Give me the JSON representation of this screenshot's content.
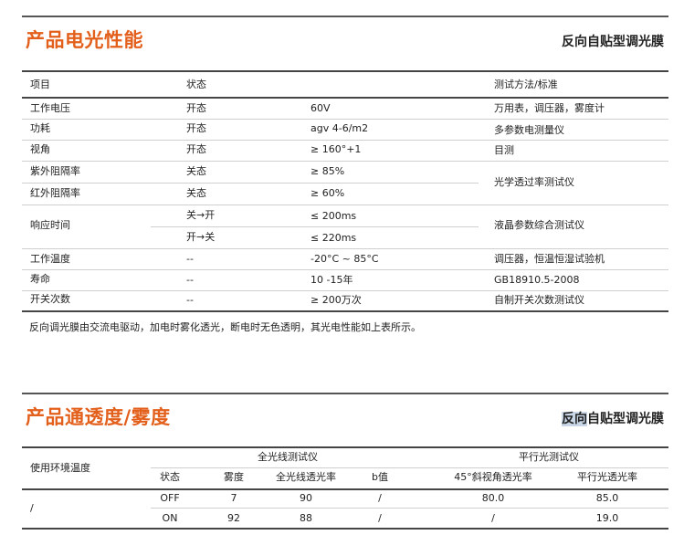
{
  "section1": {
    "title": "产品电光性能",
    "subtitle": "反向自贴型调光膜",
    "headers": {
      "item": "项目",
      "state": "状态",
      "method": "测试方法/标准"
    },
    "rows": [
      {
        "item": "工作电压",
        "state": "开态",
        "value": "60V",
        "method": "万用表，调压器，雾度计"
      },
      {
        "item": "功耗",
        "state": "开态",
        "value": "agv 4-6/m2",
        "method": "多参数电测量仪"
      },
      {
        "item": "视角",
        "state": "开态",
        "value": "≥ 160°+1",
        "method": "目测"
      },
      {
        "item": "紫外阻隔率",
        "state": "关态",
        "value": "≥ 85%",
        "method": ""
      },
      {
        "item": "红外阻隔率",
        "state": "关态",
        "value": "≥ 60%",
        "method": ""
      },
      {
        "item": "",
        "state": "关→开",
        "value": "≤ 200ms",
        "method": ""
      },
      {
        "item": "",
        "state": "开→关",
        "value": "≤ 220ms",
        "method": ""
      },
      {
        "item": "工作温度",
        "state": "--",
        "value": "-20°C ~ 85°C",
        "method": "调压器，恒温恒湿试验机"
      },
      {
        "item": "寿命",
        "state": "--",
        "value": "10 -15年",
        "method": "GB18910.5-2008"
      },
      {
        "item": "开关次数",
        "state": "--",
        "value": "≥ 200万次",
        "method": "自制开关次数测试仪"
      }
    ],
    "merged": {
      "uv_ir_method": "光学透过率测试仪",
      "response_item": "响应时间",
      "response_method": "液晶参数综合测试仪"
    },
    "note": "反向调光膜由交流电驱动，加电时雾化透光，断电时无色透明，其光电性能如上表所示。"
  },
  "section2": {
    "title": "产品通透度/雾度",
    "subtitle_hl": "反向",
    "subtitle_rest": "自贴型调光膜",
    "env_header": "使用环境温度",
    "group1": "全光线测试仪",
    "group2": "平行光测试仪",
    "cols": [
      "状态",
      "雾度",
      "全光线透光率",
      "b值",
      "45°斜视角透光率",
      "平行光透光率"
    ],
    "env_value": "/",
    "rows": [
      [
        "OFF",
        "7",
        "90",
        "/",
        "80.0",
        "85.0"
      ],
      [
        "ON",
        "92",
        "88",
        "/",
        "/",
        "19.0"
      ]
    ]
  }
}
